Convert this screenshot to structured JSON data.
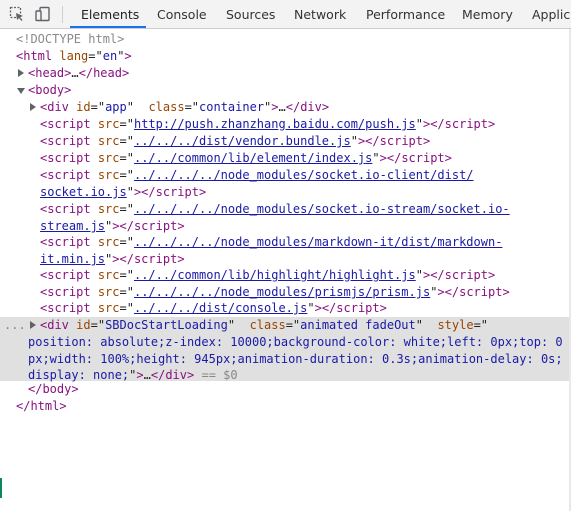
{
  "toolbar": {
    "tabs": [
      {
        "label": "Elements",
        "active": true
      },
      {
        "label": "Console"
      },
      {
        "label": "Sources"
      },
      {
        "label": "Network"
      },
      {
        "label": "Performance"
      },
      {
        "label": "Memory"
      },
      {
        "label": "Applica"
      }
    ],
    "icons": [
      "inspect-element-icon",
      "device-toolbar-icon"
    ],
    "accent_color": "#1a73e8"
  },
  "dom": {
    "doctype": "<!DOCTYPE html>",
    "html_open": {
      "tag": "html",
      "attr": "lang",
      "value": "en"
    },
    "head": {
      "text": "head",
      "ellipsis": "…"
    },
    "body": "body",
    "div_app": {
      "id_attr": "id",
      "id_value": "app",
      "class_attr": "class",
      "class_value": "container",
      "ellipsis": "…"
    },
    "scripts": [
      {
        "src": "http://push.zhanzhang.baidu.com/push.js"
      },
      {
        "src": "../../../dist/vendor.bundle.js"
      },
      {
        "src": "../../common/lib/element/index.js"
      },
      {
        "src_line1": "../../../../node_modules/socket.io-client/dist/",
        "src_line2": "socket.io.js"
      },
      {
        "src_line1": "../../../../node_modules/socket.io-stream/socket.io-",
        "src_line2": "stream.js"
      },
      {
        "src_line1": "../../../../node_modules/markdown-it/dist/markdown-",
        "src_line2": "it.min.js"
      },
      {
        "src": "../../common/lib/highlight/highlight.js"
      },
      {
        "src": "../../../../node_modules/prismjs/prism.js"
      },
      {
        "src": "../../../dist/console.js"
      }
    ],
    "selected": {
      "id_attr": "id",
      "id_value": "SBDocStartLoading",
      "class_attr": "class",
      "class_value": "animated fadeOut",
      "style_attr": "style",
      "style_value": "position: absolute;z-index: 10000;background-color: white;left: 0px;top: 0px;width: 100%;height: 945px;animation-duration: 0.3s;animation-delay: 0s;display: none;",
      "ellipsis": "…",
      "console_ref": "== $0"
    },
    "body_close": "body",
    "html_close": "html",
    "gutter_ellipsis": "..."
  }
}
